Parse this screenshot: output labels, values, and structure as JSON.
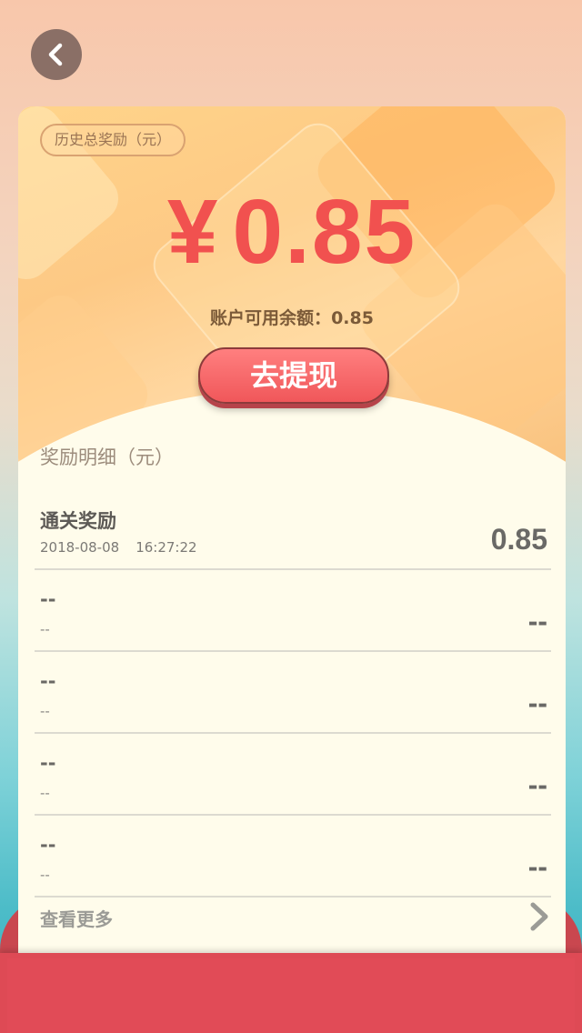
{
  "back_icon": "chevron-left-icon",
  "card": {
    "badge": "历史总奖励（元）",
    "currency_symbol": "¥",
    "total_amount": "0.85",
    "balance_label": "账户可用余额：",
    "balance_value": "0.85",
    "withdraw_label": "去提现"
  },
  "details": {
    "title": "奖励明细（元）",
    "rows": [
      {
        "title": "通关奖励",
        "date": "2018-08-08",
        "time": "16:27:22",
        "value": "0.85"
      },
      {
        "title": "--",
        "date": "--",
        "time": "",
        "value": "--"
      },
      {
        "title": "--",
        "date": "--",
        "time": "",
        "value": "--"
      },
      {
        "title": "--",
        "date": "--",
        "time": "",
        "value": "--"
      },
      {
        "title": "--",
        "date": "--",
        "time": "",
        "value": "--"
      }
    ],
    "more_label": "查看更多",
    "more_icon": "chevron-right-icon"
  },
  "colors": {
    "accent_red": "#f1514f",
    "button_red": "#f0575a",
    "card_bg": "#fffceb",
    "envelope_red": "#de4a55"
  }
}
